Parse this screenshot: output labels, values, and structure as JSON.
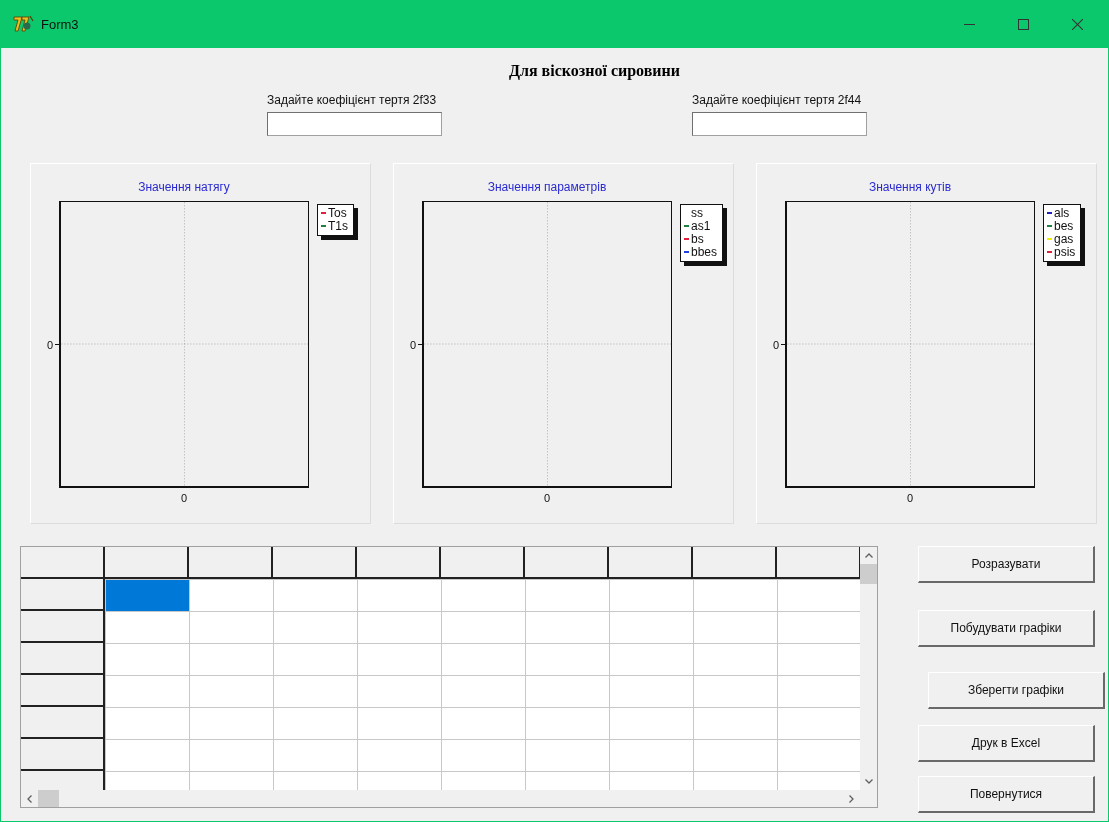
{
  "window": {
    "title": "Form3"
  },
  "heading": "Для віскозної сировини",
  "fields": [
    {
      "label": "Задайте коефіцієнт тертя 2f33"
    },
    {
      "label": "Задайте коефіцієнт тертя 2f44"
    }
  ],
  "charts": [
    {
      "title": "Значення натягу",
      "y_tick": "0",
      "x_tick": "0",
      "legend": [
        {
          "label": "Tos",
          "color": "#e0203c"
        },
        {
          "label": "T1s",
          "color": "#208040"
        }
      ]
    },
    {
      "title": "Значення параметрів",
      "y_tick": "0",
      "x_tick": "0",
      "legend": [
        {
          "label": "ss"
        },
        {
          "label": "as1",
          "color": "#208040"
        },
        {
          "label": "bs",
          "color": "#e0203c"
        },
        {
          "label": "bbes",
          "color": "#2040e0"
        }
      ]
    },
    {
      "title": "Значення кутів",
      "y_tick": "0",
      "x_tick": "0",
      "legend": [
        {
          "label": "als",
          "color": "#2020c0"
        },
        {
          "label": "bes",
          "color": "#208040"
        },
        {
          "label": "gas",
          "color": "#f0f000"
        },
        {
          "label": "psis",
          "color": "#e0203c"
        }
      ]
    }
  ],
  "grid": {
    "rows": [
      {
        "cells": [
          {
            "selected": true
          },
          {
            "selected": false
          },
          {
            "selected": false
          },
          {
            "selected": false
          },
          {
            "selected": false
          },
          {
            "selected": false
          },
          {
            "selected": false
          },
          {
            "selected": false
          },
          {
            "selected": false
          }
        ]
      },
      {
        "cells": [
          {
            "selected": false
          },
          {
            "selected": false
          },
          {
            "selected": false
          },
          {
            "selected": false
          },
          {
            "selected": false
          },
          {
            "selected": false
          },
          {
            "selected": false
          },
          {
            "selected": false
          },
          {
            "selected": false
          }
        ]
      },
      {
        "cells": [
          {
            "selected": false
          },
          {
            "selected": false
          },
          {
            "selected": false
          },
          {
            "selected": false
          },
          {
            "selected": false
          },
          {
            "selected": false
          },
          {
            "selected": false
          },
          {
            "selected": false
          },
          {
            "selected": false
          }
        ]
      },
      {
        "cells": [
          {
            "selected": false
          },
          {
            "selected": false
          },
          {
            "selected": false
          },
          {
            "selected": false
          },
          {
            "selected": false
          },
          {
            "selected": false
          },
          {
            "selected": false
          },
          {
            "selected": false
          },
          {
            "selected": false
          }
        ]
      },
      {
        "cells": [
          {
            "selected": false
          },
          {
            "selected": false
          },
          {
            "selected": false
          },
          {
            "selected": false
          },
          {
            "selected": false
          },
          {
            "selected": false
          },
          {
            "selected": false
          },
          {
            "selected": false
          },
          {
            "selected": false
          }
        ]
      },
      {
        "cells": [
          {
            "selected": false
          },
          {
            "selected": false
          },
          {
            "selected": false
          },
          {
            "selected": false
          },
          {
            "selected": false
          },
          {
            "selected": false
          },
          {
            "selected": false
          },
          {
            "selected": false
          },
          {
            "selected": false
          }
        ]
      },
      {
        "cells": [
          {
            "selected": false
          },
          {
            "selected": false
          },
          {
            "selected": false
          },
          {
            "selected": false
          },
          {
            "selected": false
          },
          {
            "selected": false
          },
          {
            "selected": false
          },
          {
            "selected": false
          },
          {
            "selected": false
          }
        ]
      }
    ]
  },
  "buttons": [
    {
      "label": "Розразувати"
    },
    {
      "label": "Побудувати графіки"
    },
    {
      "label": "Зберегти графіки"
    },
    {
      "label": "Друк в Excel"
    },
    {
      "label": "Повернутися"
    }
  ]
}
